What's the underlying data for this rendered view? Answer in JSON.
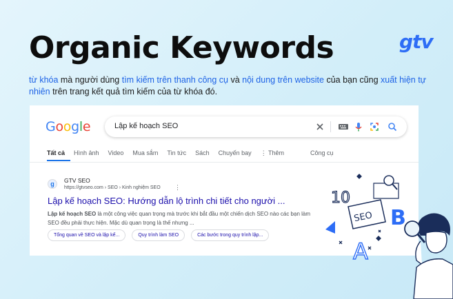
{
  "title": "Organic Keywords",
  "logo_text": "gtv",
  "description": {
    "part1": "từ khóa",
    "part2": " mà người dùng ",
    "part3": "tìm kiếm trên thanh công cụ",
    "part4": " và ",
    "part5": "nội dung trên website",
    "part6": " của bạn cũng ",
    "part7": "xuất hiện tự nhiên",
    "part8": " trên trang kết quả tìm kiếm của từ khóa đó."
  },
  "search": {
    "query": "Lập kế hoạch SEO"
  },
  "tabs": [
    "Tất cả",
    "Hình ảnh",
    "Video",
    "Mua sắm",
    "Tin tức",
    "Sách",
    "Chuyến bay",
    "⋮ Thêm",
    "Công cụ"
  ],
  "result": {
    "favicon": "g",
    "site_name": "GTV SEO",
    "url": "https://gtvseo.com › SEO › Kinh nghiệm SEO",
    "title": "Lập kế hoạch SEO: Hướng dẫn lộ trình chi tiết cho người ...",
    "snippet_bold": "Lập kế hoạch SEO",
    "snippet_rest": " là một công việc quan trọng mà trước khi bắt đầu một chiến dịch SEO nào các bạn làm SEO đều phải thực hiện. Mặc dù quan trọng là thế nhưng ...",
    "chips": [
      "Tổng quan về SEO và lập kế...",
      "Quy trình làm SEO",
      "Các bước trong quy trình lập..."
    ]
  },
  "illustration": {
    "number": "10",
    "tag": "SEO",
    "letter_b": "B",
    "letter_a": "A"
  },
  "colors": {
    "accent_blue": "#1e63e6",
    "logo_blue": "#2d6df6",
    "link_blue": "#1a0dab",
    "google_blue": "#4285f4",
    "google_red": "#ea4335",
    "google_yellow": "#fbbc05",
    "google_green": "#34a853"
  },
  "icons": [
    "clear-icon",
    "keyboard-icon",
    "microphone-icon",
    "lens-icon",
    "search-icon"
  ]
}
